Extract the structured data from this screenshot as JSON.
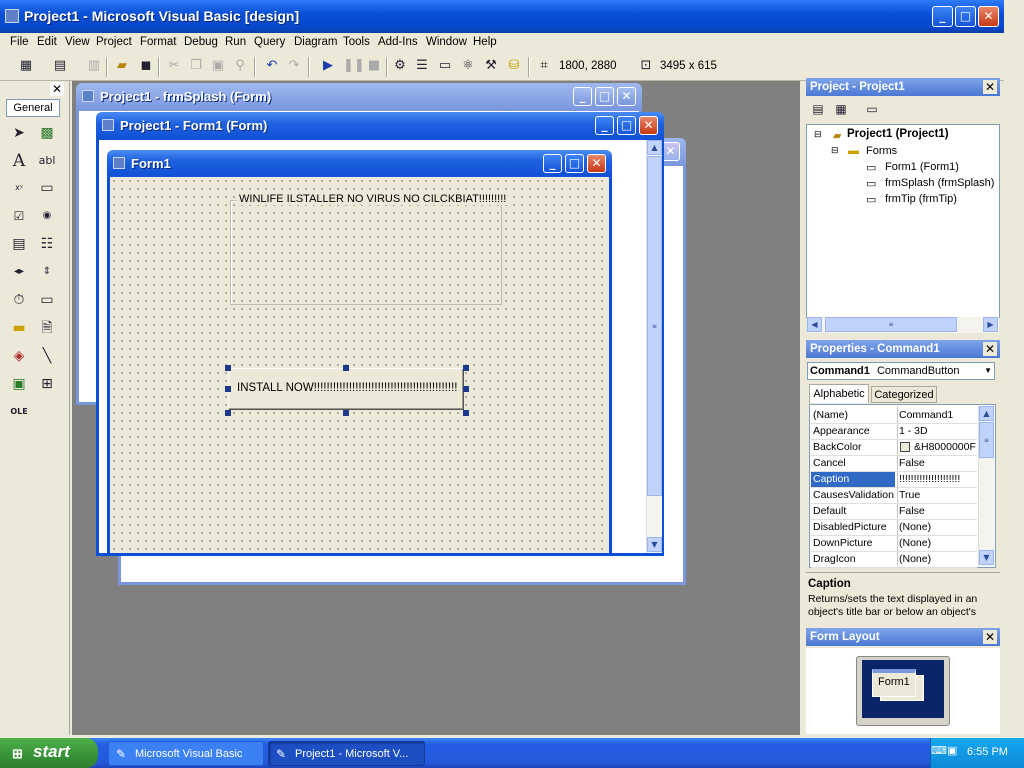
{
  "app": {
    "title": "Project1 - Microsoft Visual Basic [design]"
  },
  "menu": [
    "File",
    "Edit",
    "View",
    "Project",
    "Format",
    "Debug",
    "Run",
    "Query",
    "Diagram",
    "Tools",
    "Add-Ins",
    "Window",
    "Help"
  ],
  "toolbar": {
    "position": "1800, 2880",
    "size": "3495 x 615"
  },
  "toolbox": {
    "tab_label": "General",
    "icons": [
      "pointer-icon",
      "picturebox-icon",
      "label-icon",
      "textbox-icon",
      "frame-icon",
      "commandbutton-icon",
      "checkbox-icon",
      "optionbutton-icon",
      "combobox-icon",
      "listbox-icon",
      "hscrollbar-icon",
      "vscrollbar-icon",
      "timer-icon",
      "drivelistbox-icon",
      "dirlistbox-icon",
      "filelistbox-icon",
      "shape-icon",
      "line-icon",
      "image-icon",
      "data-icon",
      "ole-icon"
    ]
  },
  "windows": {
    "splash_title": "Project1 - frmSplash (Form)",
    "form1_designer_title": "Project1 - Form1 (Form)",
    "form1_title": "Form1"
  },
  "form1": {
    "frame_caption": "WINLIFE ILSTALLER NO VIRUS NO CILCKBIAT!!!!!!!!!",
    "button_caption": "INSTALL NOW!!!!!!!!!!!!!!!!!!!!!!!!!!!!!!!!!!!!!!!!!!!!!"
  },
  "project_panel": {
    "title": "Project - Project1",
    "root": "Project1 (Project1)",
    "folder": "Forms",
    "items": [
      "Form1 (Form1)",
      "frmSplash (frmSplash)",
      "frmTip (frmTip)"
    ]
  },
  "properties_panel": {
    "title": "Properties - Command1",
    "object_name": "Command1",
    "object_type": "CommandButton",
    "tabs": [
      "Alphabetic",
      "Categorized"
    ],
    "rows": [
      {
        "name": "(Name)",
        "value": "Command1"
      },
      {
        "name": "Appearance",
        "value": "1 - 3D"
      },
      {
        "name": "BackColor",
        "value": "&H8000000F"
      },
      {
        "name": "Cancel",
        "value": "False"
      },
      {
        "name": "Caption",
        "value": "!!!!!!!!!!!!!!!!!!!!!"
      },
      {
        "name": "CausesValidation",
        "value": "True"
      },
      {
        "name": "Default",
        "value": "False"
      },
      {
        "name": "DisabledPicture",
        "value": "(None)"
      },
      {
        "name": "DownPicture",
        "value": "(None)"
      },
      {
        "name": "DragIcon",
        "value": "(None)"
      }
    ],
    "desc_title": "Caption",
    "desc_text": "Returns/sets the text displayed in an object's title bar or below an object's"
  },
  "form_layout": {
    "title": "Form Layout",
    "preview_label": "Form1"
  },
  "taskbar": {
    "start_label": "start",
    "tasks": [
      "Microsoft Visual Basic",
      "Project1 - Microsoft V..."
    ],
    "clock": "6:55 PM"
  },
  "colors": {
    "title_blue": "#0a50d8",
    "selection": "#316ac5",
    "start_green": "#3a963a"
  }
}
